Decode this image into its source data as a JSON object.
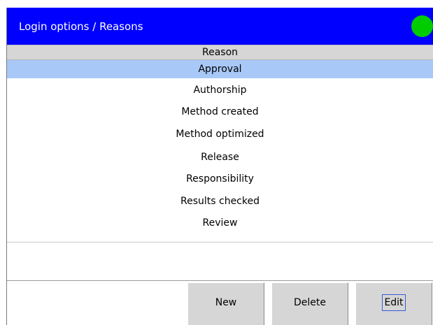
{
  "window": {
    "title": "Login options / Reasons",
    "status_color": "#00cc00",
    "status_icon": "green-status-dot"
  },
  "table": {
    "column_header": "Reason",
    "rows": [
      "Approval",
      "Authorship",
      "Method created",
      "Method optimized",
      "Release",
      "Responsibility",
      "Results checked",
      "Review"
    ],
    "selected": "Approval"
  },
  "buttons": {
    "new_label": "New",
    "delete_label": "Delete",
    "edit_label": "Edit"
  },
  "colors": {
    "titlebar": "#0000ff",
    "selection": "#a8c8f8",
    "header": "#d6d6d6"
  }
}
